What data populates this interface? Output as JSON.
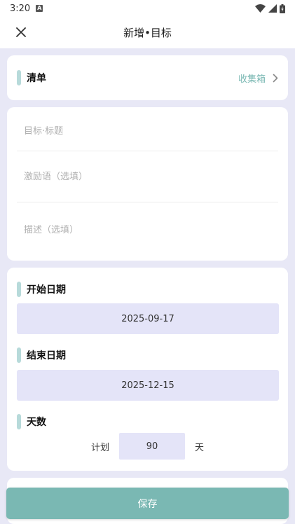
{
  "status_bar": {
    "time": "3:20",
    "notification_letter": "A"
  },
  "header": {
    "title": "新增•目标"
  },
  "list_section": {
    "label": "清单",
    "value": "收集箱"
  },
  "inputs": {
    "title_placeholder": "目标·标题",
    "motto_placeholder": "激励语（选填）",
    "desc_placeholder": "描述（选填）"
  },
  "dates": {
    "start_label": "开始日期",
    "start_value": "2025-09-17",
    "end_label": "结束日期",
    "end_value": "2025-12-15",
    "days_label": "天数",
    "plan_prefix": "计划",
    "days_value": "90",
    "days_unit": "天"
  },
  "actions": {
    "save_label": "保存"
  },
  "colors": {
    "accent": "#7ab8b3",
    "background": "#e8e8f6",
    "field_bg": "#e4e4f8"
  }
}
